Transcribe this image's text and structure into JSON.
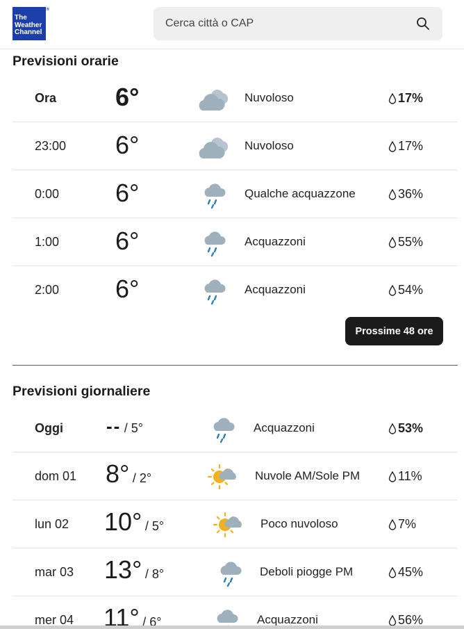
{
  "header": {
    "logo_lines": [
      "The",
      "Weather",
      "Channel"
    ],
    "search_placeholder": "Cerca città o CAP"
  },
  "hourly": {
    "title": "Previsioni orarie",
    "rows": [
      {
        "time": "Ora",
        "temp": "6°",
        "condition": "Nuvoloso",
        "precip": "17%",
        "icon": "cloudy-icon"
      },
      {
        "time": "23:00",
        "temp": "6°",
        "condition": "Nuvoloso",
        "precip": "17%",
        "icon": "cloudy-icon"
      },
      {
        "time": "0:00",
        "temp": "6°",
        "condition": "Qualche acquazzone",
        "precip": "36%",
        "icon": "rain-showers-icon"
      },
      {
        "time": "1:00",
        "temp": "6°",
        "condition": "Acquazzoni",
        "precip": "55%",
        "icon": "rain-showers-icon"
      },
      {
        "time": "2:00",
        "temp": "6°",
        "condition": "Acquazzoni",
        "precip": "54%",
        "icon": "rain-showers-icon"
      }
    ],
    "more_button": "Prossime 48 ore"
  },
  "daily": {
    "title": "Previsioni giornaliere",
    "rows": [
      {
        "day": "Oggi",
        "high": "--",
        "low": "5°",
        "condition": "Acquazzoni",
        "precip": "53%",
        "icon": "rain-showers-icon"
      },
      {
        "day": "dom 01",
        "high": "8°",
        "low": "2°",
        "condition": "Nuvole AM/Sole PM",
        "precip": "11%",
        "icon": "partly-sunny-icon"
      },
      {
        "day": "lun 02",
        "high": "10°",
        "low": "5°",
        "condition": "Poco nuvoloso",
        "precip": "7%",
        "icon": "partly-sunny-icon"
      },
      {
        "day": "mar 03",
        "high": "13°",
        "low": "8°",
        "condition": "Deboli piogge PM",
        "precip": "45%",
        "icon": "rain-showers-icon"
      },
      {
        "day": "mer 04",
        "high": "11°",
        "low": "6°",
        "condition": "Acquazzoni",
        "precip": "56%",
        "icon": "rain-showers-icon"
      }
    ]
  },
  "colors": {
    "logo_bg": "#1c3ea8",
    "cloud": "#9fb0bd",
    "rain": "#2f7fb5",
    "sun": "#f2b01e",
    "button_bg": "#1b1b1b"
  }
}
